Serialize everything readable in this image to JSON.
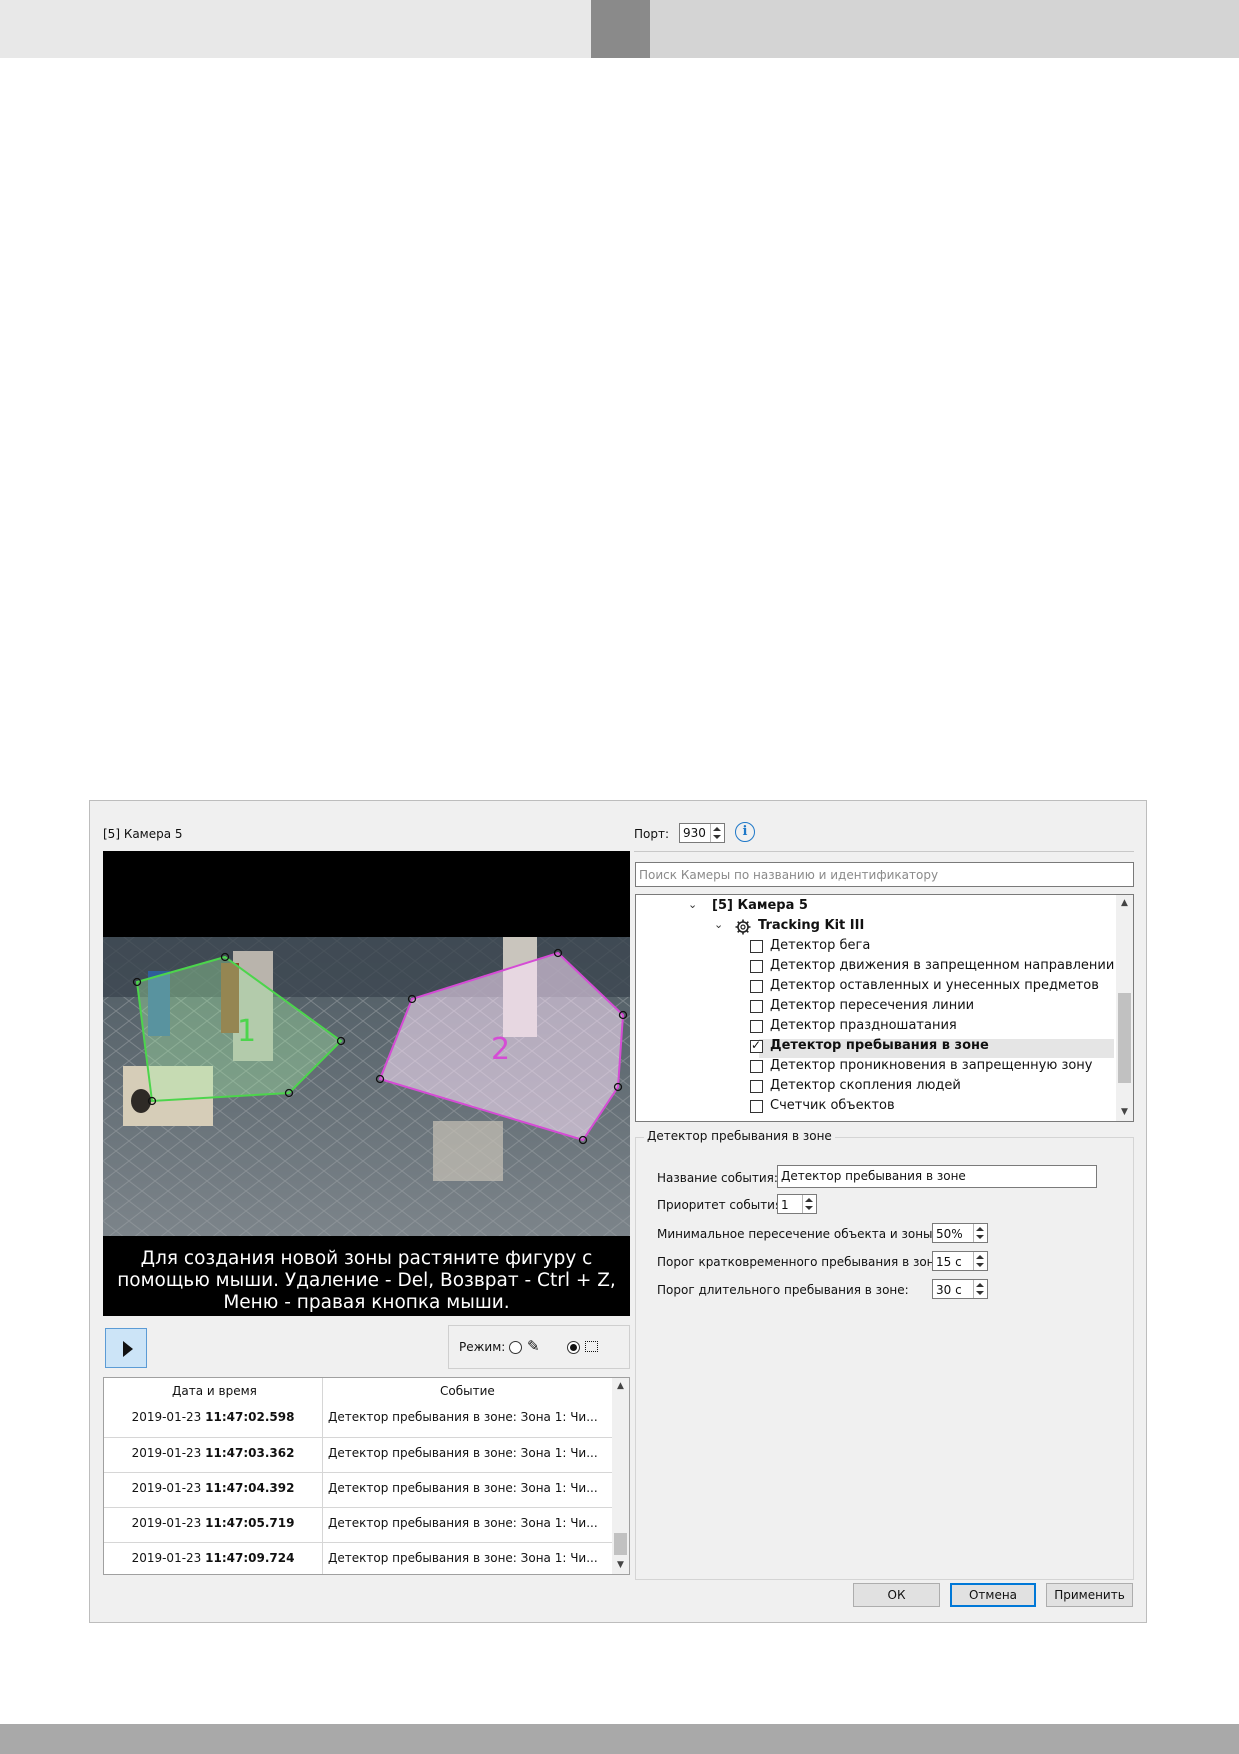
{
  "camera_title": "[5] Камера 5",
  "video": {
    "zones": [
      {
        "label": "1",
        "color": "#4cd54c"
      },
      {
        "label": "2",
        "color": "#d54cd5"
      }
    ],
    "hint": "Для создания новой зоны растяните фигуру с помощью мыши. Удаление - Del, Возврат - Ctrl + Z, Меню - правая кнопка мыши."
  },
  "mode": {
    "label": "Режим:"
  },
  "events": {
    "headers": {
      "datetime": "Дата и время",
      "event": "Событие"
    },
    "rows": [
      {
        "date": "2019-01-23 ",
        "time": "11:47:02.598",
        "text": "Детектор пребывания в зоне: Зона 1: Чи..."
      },
      {
        "date": "2019-01-23 ",
        "time": "11:47:03.362",
        "text": "Детектор пребывания в зоне: Зона 1: Чи..."
      },
      {
        "date": "2019-01-23 ",
        "time": "11:47:04.392",
        "text": "Детектор пребывания в зоне: Зона 1: Чи..."
      },
      {
        "date": "2019-01-23 ",
        "time": "11:47:05.719",
        "text": "Детектор пребывания в зоне: Зона 1: Чи..."
      },
      {
        "date": "2019-01-23 ",
        "time": "11:47:09.724",
        "text": "Детектор пребывания в зоне: Зона 1: Чи..."
      }
    ]
  },
  "port": {
    "label": "Порт:",
    "value": "930"
  },
  "search": {
    "placeholder": "Поиск Камеры по названию и идентификатору"
  },
  "tree": {
    "camera": "[5] Камера 5",
    "kit": "Tracking Kit III",
    "detectors": [
      {
        "label": "Детектор бега",
        "checked": false
      },
      {
        "label": "Детектор движения в запрещенном направлении",
        "checked": false
      },
      {
        "label": "Детектор оставленных и унесенных предметов",
        "checked": false
      },
      {
        "label": "Детектор пересечения линии",
        "checked": false
      },
      {
        "label": "Детектор праздношатания",
        "checked": false
      },
      {
        "label": "Детектор пребывания в зоне",
        "checked": true
      },
      {
        "label": "Детектор проникновения в запрещенную зону",
        "checked": false
      },
      {
        "label": "Детектор скопления людей",
        "checked": false
      },
      {
        "label": "Счетчик объектов",
        "checked": false
      }
    ]
  },
  "settings": {
    "title": "Детектор пребывания в зоне",
    "event_name_label": "Название события:",
    "event_name_value": "Детектор пребывания в зоне",
    "priority_label": "Приоритет события:",
    "priority_value": "1",
    "min_overlap_label": "Минимальное пересечение объекта и зоны:",
    "min_overlap_value": "50%",
    "short_stay_label": "Порог кратковременного пребывания в зоне:",
    "short_stay_value": "15 с",
    "long_stay_label": "Порог длительного пребывания в зоне:",
    "long_stay_value": "30 с"
  },
  "buttons": {
    "ok": "ОК",
    "cancel": "Отмена",
    "apply": "Применить"
  },
  "colors": {
    "accent": "#0078d7",
    "selected_row": "#e5e5e5"
  }
}
